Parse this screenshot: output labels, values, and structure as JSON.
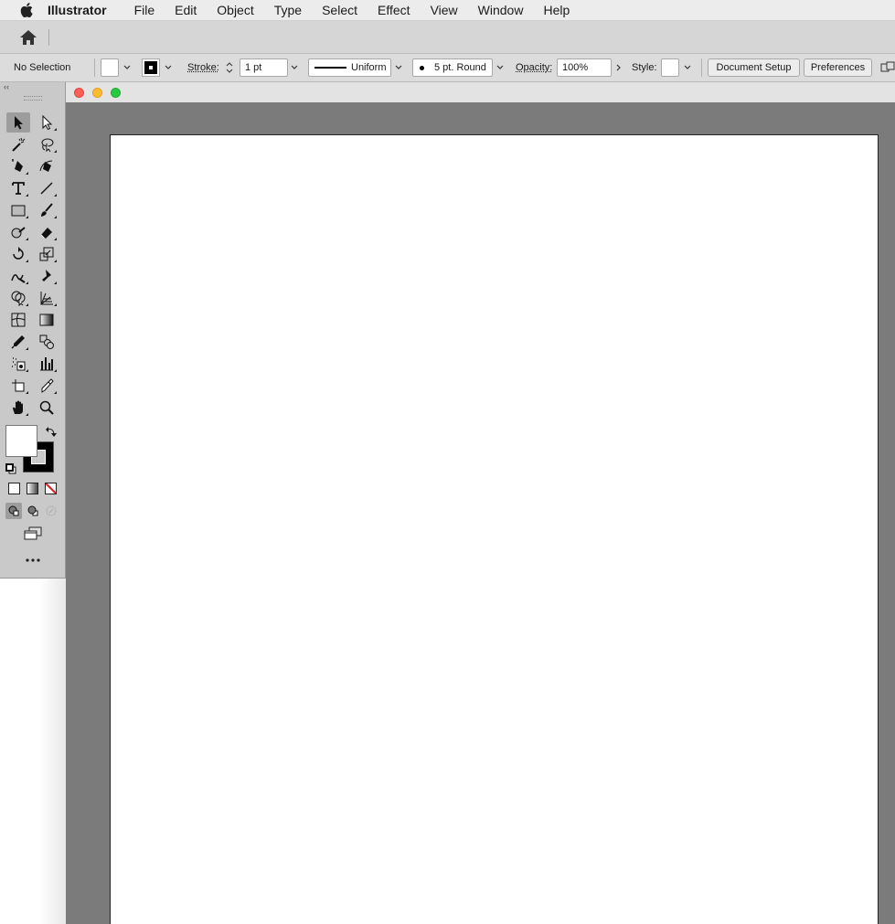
{
  "menubar": {
    "app_name": "Illustrator",
    "items": [
      "File",
      "Edit",
      "Object",
      "Type",
      "Select",
      "Effect",
      "View",
      "Window",
      "Help"
    ]
  },
  "control": {
    "selection_label": "No Selection",
    "stroke_label": "Stroke:",
    "stroke_weight": "1 pt",
    "profile_label": "Uniform",
    "brush_label": "5 pt. Round",
    "opacity_label": "Opacity:",
    "opacity_value": "100%",
    "style_label": "Style:",
    "document_setup": "Document Setup",
    "preferences": "Preferences"
  },
  "colors": {
    "fill": "#ffffff",
    "stroke": "#000000",
    "close": "#fe5f57",
    "minimize": "#febc2e",
    "zoom": "#28c840"
  },
  "tools": [
    "selection-tool",
    "direct-selection-tool",
    "magic-wand-tool",
    "lasso-tool",
    "pen-tool",
    "curvature-tool",
    "type-tool",
    "line-segment-tool",
    "rectangle-tool",
    "paintbrush-tool",
    "shaper-tool",
    "eraser-tool",
    "rotate-tool",
    "scale-tool",
    "warp-tool",
    "puppet-warp-tool",
    "shape-builder-tool",
    "perspective-grid-tool",
    "mesh-tool",
    "gradient-tool",
    "eyedropper-tool",
    "blend-tool",
    "symbol-sprayer-tool",
    "column-graph-tool",
    "artboard-tool",
    "slice-tool",
    "hand-tool",
    "zoom-tool"
  ]
}
